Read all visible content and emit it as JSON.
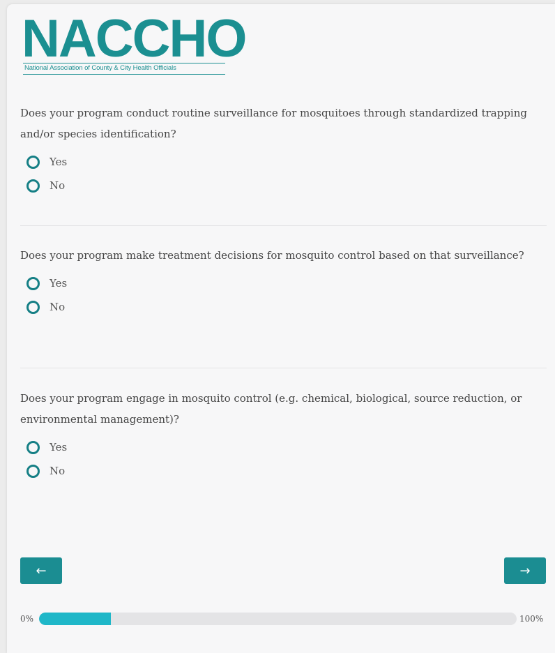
{
  "logo": {
    "name": "NACCHO",
    "tagline": "National Association of County & City Health Officials",
    "color": "#1b8f91"
  },
  "questions": [
    {
      "text": "Does your program conduct routine surveillance for mosquitoes through standardized trapping and/or species identification?",
      "options": [
        "Yes",
        "No"
      ]
    },
    {
      "text": "Does your program make treatment decisions for mosquito control based on that surveillance?",
      "options": [
        "Yes",
        "No"
      ]
    },
    {
      "text": "Does your program engage in mosquito control (e.g. chemical, biological, source reduction, or environmental management)?",
      "options": [
        "Yes",
        "No"
      ]
    }
  ],
  "nav": {
    "back_icon": "arrow-left-icon",
    "back_label": "←",
    "next_icon": "arrow-right-icon",
    "next_label": "→",
    "button_color": "#1b8d92"
  },
  "progress": {
    "start_label": "0%",
    "end_label": "100%",
    "fraction": 0.15,
    "fill_color": "#1fb7c8"
  }
}
